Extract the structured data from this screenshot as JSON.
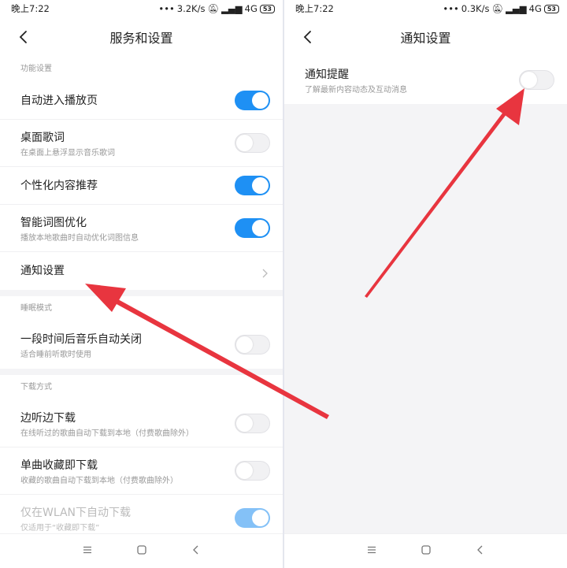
{
  "left": {
    "status": {
      "time": "晚上7:22",
      "speed": "3.2K/s",
      "network": "4G",
      "battery": "53"
    },
    "title": "服务和设置",
    "sections": [
      {
        "header": "功能设置",
        "rows": [
          {
            "title": "自动进入播放页",
            "state": "on"
          },
          {
            "title": "桌面歌词",
            "sub": "在桌面上悬浮显示音乐歌词",
            "state": "off"
          },
          {
            "title": "个性化内容推荐",
            "state": "on"
          },
          {
            "title": "智能词图优化",
            "sub": "播放本地歌曲时自动优化词图信息",
            "state": "on"
          },
          {
            "title": "通知设置"
          }
        ]
      },
      {
        "header": "睡眠模式",
        "rows": [
          {
            "title": "一段时间后音乐自动关闭",
            "sub": "适合睡前听歌时使用",
            "state": "off"
          }
        ]
      },
      {
        "header": "下载方式",
        "rows": [
          {
            "title": "边听边下载",
            "sub": "在线听过的歌曲自动下载到本地（付费歌曲除外）",
            "state": "off"
          },
          {
            "title": "单曲收藏即下载",
            "sub": "收藏的歌曲自动下载到本地（付费歌曲除外）",
            "state": "off"
          },
          {
            "title": "仅在WLAN下自动下载",
            "sub": "仅适用于“收藏即下载”",
            "state": "on-disabled"
          }
        ]
      }
    ]
  },
  "right": {
    "status": {
      "time": "晚上7:22",
      "speed": "0.3K/s",
      "network": "4G",
      "battery": "53"
    },
    "title": "通知设置",
    "rows": [
      {
        "title": "通知提醒",
        "sub": "了解最新内容动态及互动消息",
        "state": "off"
      }
    ]
  },
  "colors": {
    "accent": "#1e90f4",
    "arrow": "#e8353f"
  },
  "icons": [
    "back-arrow-icon",
    "chevron-right-icon",
    "menu-icon",
    "home-icon",
    "back-icon",
    "signal-icon",
    "mute-icon"
  ]
}
